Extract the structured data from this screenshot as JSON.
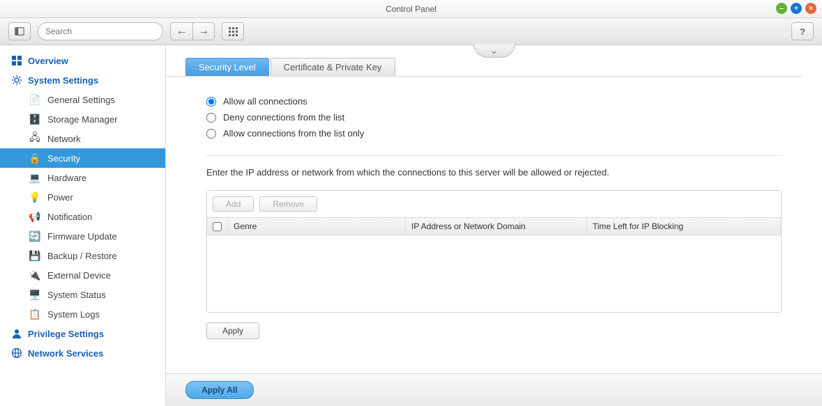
{
  "window": {
    "title": "Control Panel"
  },
  "toolbar": {
    "search_placeholder": "Search",
    "help_label": "?"
  },
  "sidebar": {
    "sections": [
      {
        "label": "Overview"
      },
      {
        "label": "System Settings",
        "items": [
          {
            "label": "General Settings"
          },
          {
            "label": "Storage Manager"
          },
          {
            "label": "Network"
          },
          {
            "label": "Security",
            "active": true
          },
          {
            "label": "Hardware"
          },
          {
            "label": "Power"
          },
          {
            "label": "Notification"
          },
          {
            "label": "Firmware Update"
          },
          {
            "label": "Backup / Restore"
          },
          {
            "label": "External Device"
          },
          {
            "label": "System Status"
          },
          {
            "label": "System Logs"
          }
        ]
      },
      {
        "label": "Privilege Settings"
      },
      {
        "label": "Network Services"
      }
    ]
  },
  "tabs": {
    "security_level": "Security Level",
    "certificate": "Certificate & Private Key"
  },
  "radios": {
    "allow_all": "Allow all connections",
    "deny_list": "Deny connections from the list",
    "allow_list": "Allow connections from the list only"
  },
  "instruction": "Enter the IP address or network from which the connections to this server will be allowed or rejected.",
  "table": {
    "add_btn": "Add",
    "remove_btn": "Remove",
    "col_genre": "Genre",
    "col_ip": "IP Address or Network Domain",
    "col_time": "Time Left for IP Blocking",
    "rows": []
  },
  "apply_btn": "Apply",
  "apply_all_btn": "Apply All"
}
